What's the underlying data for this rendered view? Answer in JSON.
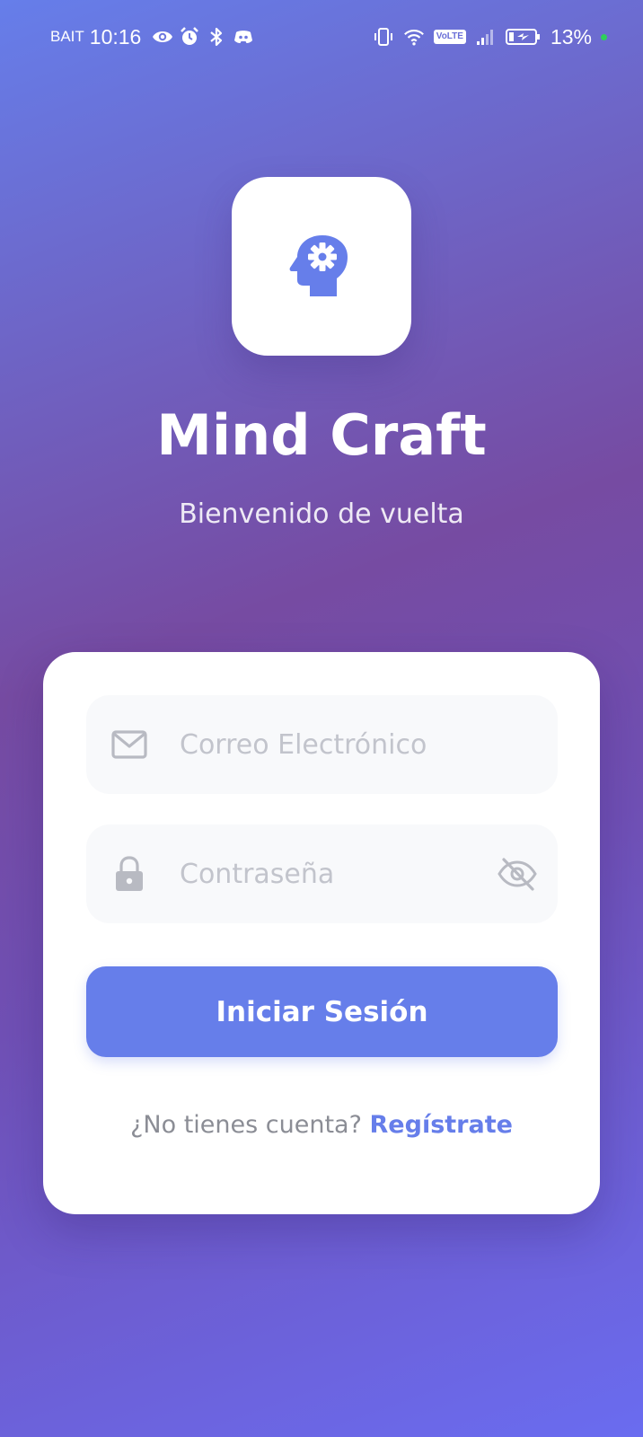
{
  "status_bar": {
    "carrier": "BAIT",
    "time": "10:16",
    "volte_label": "VoLTE",
    "battery_percent": "13%",
    "left_icons": [
      "eye-icon",
      "alarm-icon",
      "bluetooth-icon",
      "discord-icon"
    ],
    "right_icons": [
      "vibrate-icon",
      "wifi-icon",
      "volte-icon",
      "signal-icon",
      "battery-charging-icon"
    ],
    "battery_dot_color": "#2fd05a"
  },
  "header": {
    "logo_icon": "head-gear-icon",
    "title": "Mind Craft",
    "subtitle": "Bienvenido de vuelta"
  },
  "form": {
    "email": {
      "icon": "mail-icon",
      "placeholder": "Correo Electrónico",
      "value": ""
    },
    "password": {
      "icon": "lock-icon",
      "placeholder": "Contraseña",
      "value": "",
      "toggle_icon": "eye-off-icon"
    },
    "submit_label": "Iniciar Sesión",
    "signup_prompt": "¿No tienes cuenta?",
    "signup_link": "Regístrate"
  },
  "colors": {
    "accent": "#667eea",
    "gradient_start": "#667eea",
    "gradient_mid": "#764ba2",
    "gradient_end": "#6a6cf0",
    "card_background": "#ffffff",
    "field_background": "#f8f9fb",
    "placeholder": "#c2c4cc",
    "muted_text": "#8b8d95"
  }
}
